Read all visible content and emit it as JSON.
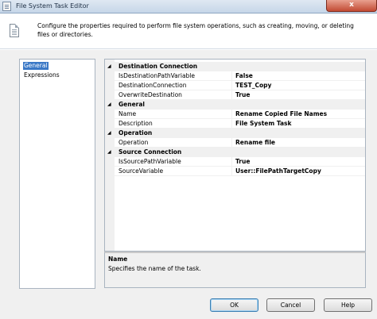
{
  "window": {
    "title": "File System Task Editor",
    "close_label": "x"
  },
  "header": {
    "description": "Configure the properties required to perform file system operations, such as creating, moving, or deleting files or directories."
  },
  "nav": {
    "items": [
      {
        "label": "General",
        "selected": true
      },
      {
        "label": "Expressions",
        "selected": false
      }
    ]
  },
  "property_grid": {
    "categories": [
      {
        "label": "Destination Connection",
        "properties": [
          {
            "name": "IsDestinationPathVariable",
            "value": "False"
          },
          {
            "name": "DestinationConnection",
            "value": "TEST_Copy"
          },
          {
            "name": "OverwriteDestination",
            "value": "True"
          }
        ]
      },
      {
        "label": "General",
        "properties": [
          {
            "name": "Name",
            "value": "Rename Copied File Names"
          },
          {
            "name": "Description",
            "value": "File System Task"
          }
        ]
      },
      {
        "label": "Operation",
        "properties": [
          {
            "name": "Operation",
            "value": "Rename file"
          }
        ]
      },
      {
        "label": "Source Connection",
        "properties": [
          {
            "name": "IsSourcePathVariable",
            "value": "True"
          },
          {
            "name": "SourceVariable",
            "value": "User::FilePathTargetCopy"
          }
        ]
      }
    ],
    "collapse_glyph": "◢"
  },
  "description_panel": {
    "title": "Name",
    "text": "Specifies the name of the task."
  },
  "buttons": {
    "ok": "OK",
    "cancel": "Cancel",
    "help": "Help"
  }
}
